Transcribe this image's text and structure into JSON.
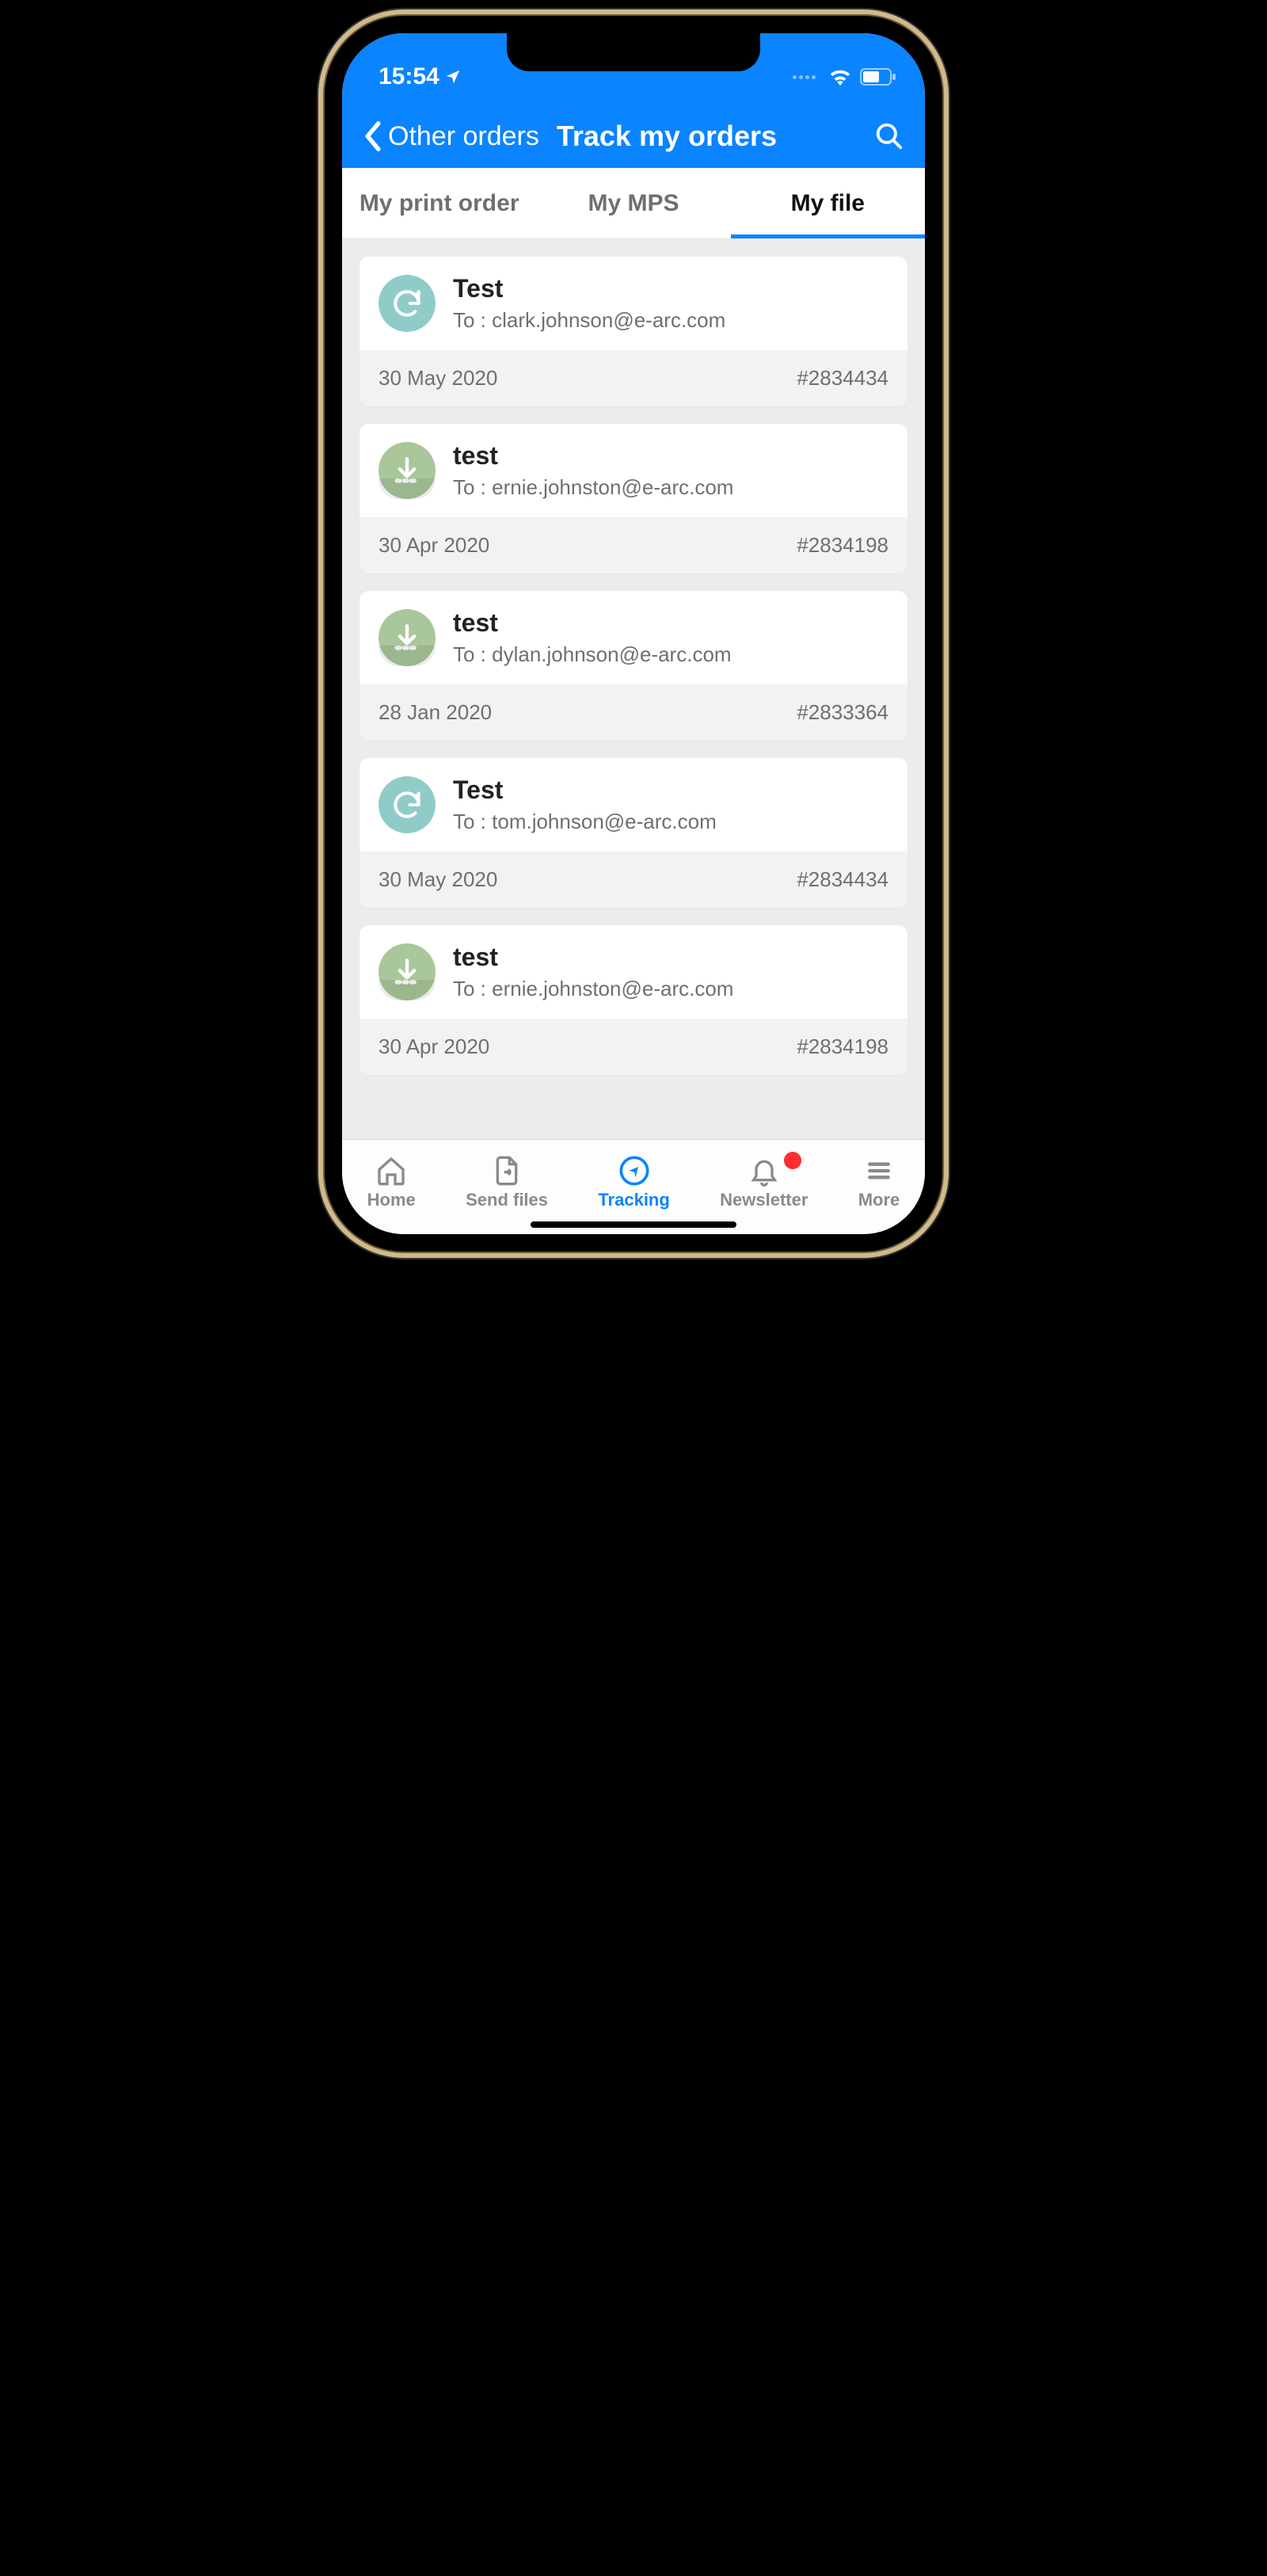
{
  "status": {
    "time": "15:54"
  },
  "nav": {
    "back_label": "Other orders",
    "title": "Track my orders"
  },
  "tabs": [
    {
      "label": "My print order",
      "active": false
    },
    {
      "label": "My MPS",
      "active": false
    },
    {
      "label": "My file",
      "active": true
    }
  ],
  "files": [
    {
      "icon": "sync",
      "title": "Test",
      "to": "To : clark.johnson@e-arc.com",
      "date": "30 May 2020",
      "order": "#2834434"
    },
    {
      "icon": "download",
      "title": "test",
      "to": "To : ernie.johnston@e-arc.com",
      "date": "30 Apr 2020",
      "order": "#2834198"
    },
    {
      "icon": "download",
      "title": "test",
      "to": "To :  dylan.johnson@e-arc.com",
      "date": "28 Jan 2020",
      "order": "#2833364"
    },
    {
      "icon": "sync",
      "title": "Test",
      "to": "To :   tom.johnson@e-arc.com",
      "date": "30 May 2020",
      "order": "#2834434"
    },
    {
      "icon": "download",
      "title": "test",
      "to": "To : ernie.johnston@e-arc.com",
      "date": "30 Apr 2020",
      "order": "#2834198"
    }
  ],
  "bottom": [
    {
      "label": "Home"
    },
    {
      "label": "Send files"
    },
    {
      "label": "Tracking"
    },
    {
      "label": "Newsletter"
    },
    {
      "label": "More"
    }
  ]
}
